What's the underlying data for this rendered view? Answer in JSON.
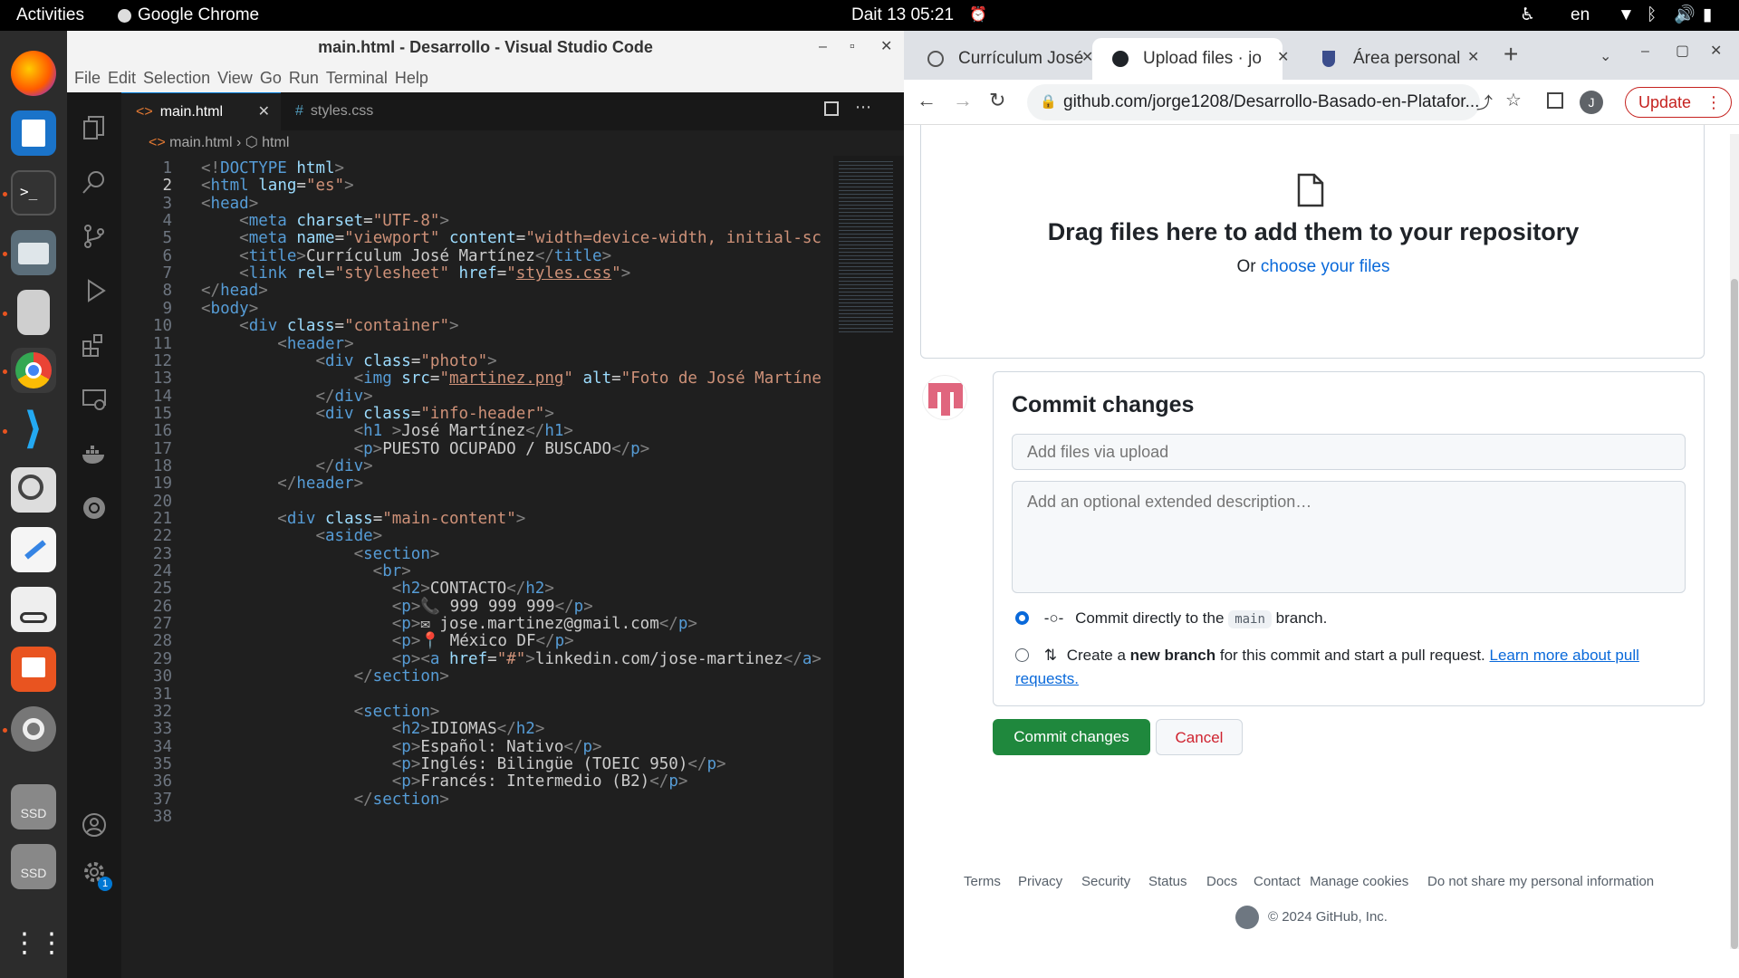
{
  "topbar": {
    "activities": "Activities",
    "app": "Google Chrome",
    "clock": "Dait 13  05:21",
    "lang": "en"
  },
  "dock": {
    "items": [
      "firefox-icon",
      "writer-icon",
      "terminal-icon",
      "files-icon",
      "usb-drive-icon",
      "chrome-icon",
      "vscode-icon",
      "magnifier-icon",
      "text-editor-icon",
      "document-viewer-icon",
      "presentation-icon",
      "settings-icon",
      "ssd-drive-icon",
      "ssd-drive-icon"
    ],
    "ssd_label": "SSD"
  },
  "vscode": {
    "title": "main.html - Desarrollo - Visual Studio Code",
    "menu": [
      "File",
      "Edit",
      "Selection",
      "View",
      "Go",
      "Run",
      "Terminal",
      "Help"
    ],
    "tabs": [
      {
        "label": "main.html",
        "active": true
      },
      {
        "label": "styles.css",
        "active": false
      }
    ],
    "breadcrumb": [
      "main.html",
      "html"
    ],
    "settings_badge": "1",
    "lines": [
      {
        "n": "1",
        "html": "<span class=\"t\">&lt;!</span><span class=\"k\">DOCTYPE</span> <span class=\"a\">html</span><span class=\"t\">&gt;</span>"
      },
      {
        "n": "2",
        "html": "<span class=\"t\">&lt;</span><span class=\"k\">html</span> <span class=\"a\">lang</span>=<span class=\"s\">\"es\"</span><span class=\"t\">&gt;</span>"
      },
      {
        "n": "3",
        "html": "<span class=\"t\">&lt;</span><span class=\"k\">head</span><span class=\"t\">&gt;</span>"
      },
      {
        "n": "4",
        "html": "    <span class=\"t\">&lt;</span><span class=\"k\">meta</span> <span class=\"a\">charset</span>=<span class=\"s\">\"UTF-8\"</span><span class=\"t\">&gt;</span>"
      },
      {
        "n": "5",
        "html": "    <span class=\"t\">&lt;</span><span class=\"k\">meta</span> <span class=\"a\">name</span>=<span class=\"s\">\"viewport\"</span> <span class=\"a\">content</span>=<span class=\"s\">\"width=device-width, initial-sc</span>"
      },
      {
        "n": "6",
        "html": "    <span class=\"t\">&lt;</span><span class=\"k\">title</span><span class=\"t\">&gt;</span>Currículum José Martínez<span class=\"t\">&lt;/</span><span class=\"k\">title</span><span class=\"t\">&gt;</span>"
      },
      {
        "n": "7",
        "html": "    <span class=\"t\">&lt;</span><span class=\"k\">link</span> <span class=\"a\">rel</span>=<span class=\"s\">\"stylesheet\"</span> <span class=\"a\">href</span>=<span class=\"s\">\"<u>styles.css</u>\"</span><span class=\"t\">&gt;</span>"
      },
      {
        "n": "8",
        "html": "<span class=\"t\">&lt;/</span><span class=\"k\">head</span><span class=\"t\">&gt;</span>"
      },
      {
        "n": "9",
        "html": "<span class=\"t\">&lt;</span><span class=\"k\">body</span><span class=\"t\">&gt;</span>"
      },
      {
        "n": "10",
        "html": "    <span class=\"t\">&lt;</span><span class=\"k\">div</span> <span class=\"a\">class</span>=<span class=\"s\">\"container\"</span><span class=\"t\">&gt;</span>"
      },
      {
        "n": "11",
        "html": "        <span class=\"t\">&lt;</span><span class=\"k\">header</span><span class=\"t\">&gt;</span>"
      },
      {
        "n": "12",
        "html": "            <span class=\"t\">&lt;</span><span class=\"k\">div</span> <span class=\"a\">class</span>=<span class=\"s\">\"photo\"</span><span class=\"t\">&gt;</span>"
      },
      {
        "n": "13",
        "html": "                <span class=\"t\">&lt;</span><span class=\"k\">img</span> <span class=\"a\">src</span>=<span class=\"s\">\"<u>martinez.png</u>\"</span> <span class=\"a\">alt</span>=<span class=\"s\">\"Foto de José Martíne</span>"
      },
      {
        "n": "14",
        "html": "            <span class=\"t\">&lt;/</span><span class=\"k\">div</span><span class=\"t\">&gt;</span>"
      },
      {
        "n": "15",
        "html": "            <span class=\"t\">&lt;</span><span class=\"k\">div</span> <span class=\"a\">class</span>=<span class=\"s\">\"info-header\"</span><span class=\"t\">&gt;</span>"
      },
      {
        "n": "16",
        "html": "                <span class=\"t\">&lt;</span><span class=\"k\">h1</span> <span class=\"t\">&gt;</span>José Martínez<span class=\"t\">&lt;/</span><span class=\"k\">h1</span><span class=\"t\">&gt;</span>"
      },
      {
        "n": "17",
        "html": "                <span class=\"t\">&lt;</span><span class=\"k\">p</span><span class=\"t\">&gt;</span>PUESTO OCUPADO / BUSCADO<span class=\"t\">&lt;/</span><span class=\"k\">p</span><span class=\"t\">&gt;</span>"
      },
      {
        "n": "18",
        "html": "            <span class=\"t\">&lt;/</span><span class=\"k\">div</span><span class=\"t\">&gt;</span>"
      },
      {
        "n": "19",
        "html": "        <span class=\"t\">&lt;/</span><span class=\"k\">header</span><span class=\"t\">&gt;</span>"
      },
      {
        "n": "20",
        "html": ""
      },
      {
        "n": "21",
        "html": "        <span class=\"t\">&lt;</span><span class=\"k\">div</span> <span class=\"a\">class</span>=<span class=\"s\">\"main-content\"</span><span class=\"t\">&gt;</span>"
      },
      {
        "n": "22",
        "html": "            <span class=\"t\">&lt;</span><span class=\"k\">aside</span><span class=\"t\">&gt;</span>"
      },
      {
        "n": "23",
        "html": "                <span class=\"t\">&lt;</span><span class=\"k\">section</span><span class=\"t\">&gt;</span>"
      },
      {
        "n": "24",
        "html": "                  <span class=\"t\">&lt;</span><span class=\"k\">br</span><span class=\"t\">&gt;</span>"
      },
      {
        "n": "25",
        "html": "                    <span class=\"t\">&lt;</span><span class=\"k\">h2</span><span class=\"t\">&gt;</span>CONTACTO<span class=\"t\">&lt;/</span><span class=\"k\">h2</span><span class=\"t\">&gt;</span>"
      },
      {
        "n": "26",
        "html": "                    <span class=\"t\">&lt;</span><span class=\"k\">p</span><span class=\"t\">&gt;</span>📞 999 999 999<span class=\"t\">&lt;/</span><span class=\"k\">p</span><span class=\"t\">&gt;</span>"
      },
      {
        "n": "27",
        "html": "                    <span class=\"t\">&lt;</span><span class=\"k\">p</span><span class=\"t\">&gt;</span>✉ jose.martinez@gmail.com<span class=\"t\">&lt;/</span><span class=\"k\">p</span><span class=\"t\">&gt;</span>"
      },
      {
        "n": "28",
        "html": "                    <span class=\"t\">&lt;</span><span class=\"k\">p</span><span class=\"t\">&gt;</span>📍 México DF<span class=\"t\">&lt;/</span><span class=\"k\">p</span><span class=\"t\">&gt;</span>"
      },
      {
        "n": "29",
        "html": "                    <span class=\"t\">&lt;</span><span class=\"k\">p</span><span class=\"t\">&gt;&lt;</span><span class=\"k\">a</span> <span class=\"a\">href</span>=<span class=\"s\">\"#\"</span><span class=\"t\">&gt;</span>linkedin.com/jose-martinez<span class=\"t\">&lt;/</span><span class=\"k\">a</span><span class=\"t\">&gt;</span>"
      },
      {
        "n": "30",
        "html": "                <span class=\"t\">&lt;/</span><span class=\"k\">section</span><span class=\"t\">&gt;</span>"
      },
      {
        "n": "31",
        "html": ""
      },
      {
        "n": "32",
        "html": "                <span class=\"t\">&lt;</span><span class=\"k\">section</span><span class=\"t\">&gt;</span>"
      },
      {
        "n": "33",
        "html": "                    <span class=\"t\">&lt;</span><span class=\"k\">h2</span><span class=\"t\">&gt;</span>IDIOMAS<span class=\"t\">&lt;/</span><span class=\"k\">h2</span><span class=\"t\">&gt;</span>"
      },
      {
        "n": "34",
        "html": "                    <span class=\"t\">&lt;</span><span class=\"k\">p</span><span class=\"t\">&gt;</span>Español: Nativo<span class=\"t\">&lt;/</span><span class=\"k\">p</span><span class=\"t\">&gt;</span>"
      },
      {
        "n": "35",
        "html": "                    <span class=\"t\">&lt;</span><span class=\"k\">p</span><span class=\"t\">&gt;</span>Inglés: Bilingüe (TOEIC 950)<span class=\"t\">&lt;/</span><span class=\"k\">p</span><span class=\"t\">&gt;</span>"
      },
      {
        "n": "36",
        "html": "                    <span class=\"t\">&lt;</span><span class=\"k\">p</span><span class=\"t\">&gt;</span>Francés: Intermedio (B2)<span class=\"t\">&lt;/</span><span class=\"k\">p</span><span class=\"t\">&gt;</span>"
      },
      {
        "n": "37",
        "html": "                <span class=\"t\">&lt;/</span><span class=\"k\">section</span><span class=\"t\">&gt;</span>"
      },
      {
        "n": "38",
        "html": ""
      }
    ]
  },
  "chrome": {
    "tabs": [
      "Currículum José",
      "Upload files · jo",
      "Área personal |"
    ],
    "url": "github.com/jorge1208/Desarrollo-Basado-en-Platafor...",
    "profile": "J",
    "update": "Update",
    "drop_title": "Drag files here to add them to your repository",
    "drop_or": "Or",
    "drop_link": "choose your files",
    "commit_heading": "Commit changes",
    "summary_placeholder": "Add files via upload",
    "desc_placeholder": "Add an optional extended description…",
    "opt1_pre": "Commit directly to the",
    "opt1_branch": "main",
    "opt1_post": "branch.",
    "opt2_pre": "Create a",
    "opt2_bold": "new branch",
    "opt2_post": "for this commit and start a pull request.",
    "opt2_link": "Learn more about pull requests.",
    "commit_btn": "Commit changes",
    "cancel_btn": "Cancel",
    "footer_links": [
      "Terms",
      "Privacy",
      "Security",
      "Status",
      "Docs",
      "Contact",
      "Manage cookies",
      "Do not share my personal information"
    ],
    "copyright": "© 2024 GitHub, Inc.",
    "colors": {
      "green": "#1f883d",
      "link": "#0969da",
      "cancel": "#cf222e"
    }
  }
}
